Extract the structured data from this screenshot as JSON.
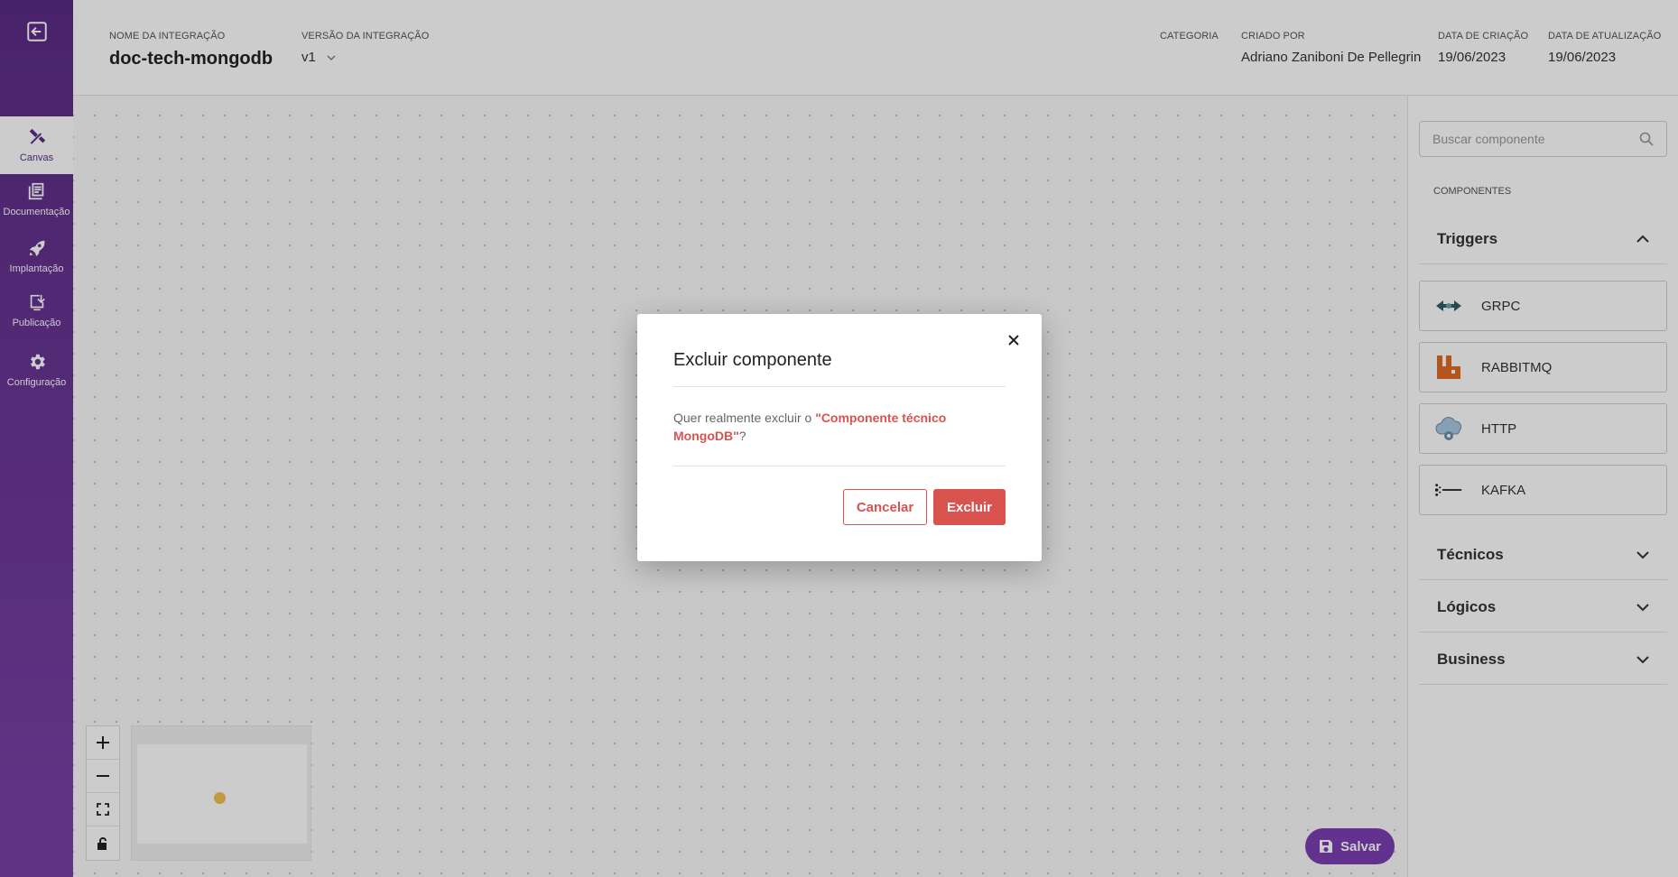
{
  "sidebar": {
    "items": [
      {
        "label": "Canvas"
      },
      {
        "label": "Documentação"
      },
      {
        "label": "Implantação"
      },
      {
        "label": "Publicação"
      },
      {
        "label": "Configuração"
      }
    ]
  },
  "header": {
    "integration_name_label": "NOME DA INTEGRAÇÃO",
    "integration_name": "doc-tech-mongodb",
    "version_label": "VERSÃO DA INTEGRAÇÃO",
    "version": "v1",
    "category_label": "CATEGORIA",
    "created_by_label": "CRIADO POR",
    "created_by": "Adriano Zaniboni De Pellegrin",
    "created_date_label": "DATA DE CRIAÇÃO",
    "created_date": "19/06/2023",
    "updated_date_label": "DATA DE ATUALIZAÇÃO",
    "updated_date": "19/06/2023"
  },
  "canvas": {
    "save_label": "Salvar"
  },
  "panel": {
    "search_placeholder": "Buscar componente",
    "components_label": "COMPONENTES",
    "sections": {
      "triggers": "Triggers",
      "tecnicos": "Técnicos",
      "logicos": "Lógicos",
      "business": "Business"
    },
    "triggers": [
      {
        "label": "GRPC"
      },
      {
        "label": "RABBITMQ"
      },
      {
        "label": "HTTP"
      },
      {
        "label": "KAFKA"
      }
    ]
  },
  "modal": {
    "title": "Excluir componente",
    "message_prefix": "Quer realmente excluir o ",
    "component_name": "\"Componente técnico MongoDB\"",
    "message_suffix": "?",
    "cancel_label": "Cancelar",
    "delete_label": "Excluir"
  },
  "colors": {
    "brand_purple": "#5b2b85",
    "save_purple": "#7b3fb2",
    "danger_red": "#d9534f"
  }
}
